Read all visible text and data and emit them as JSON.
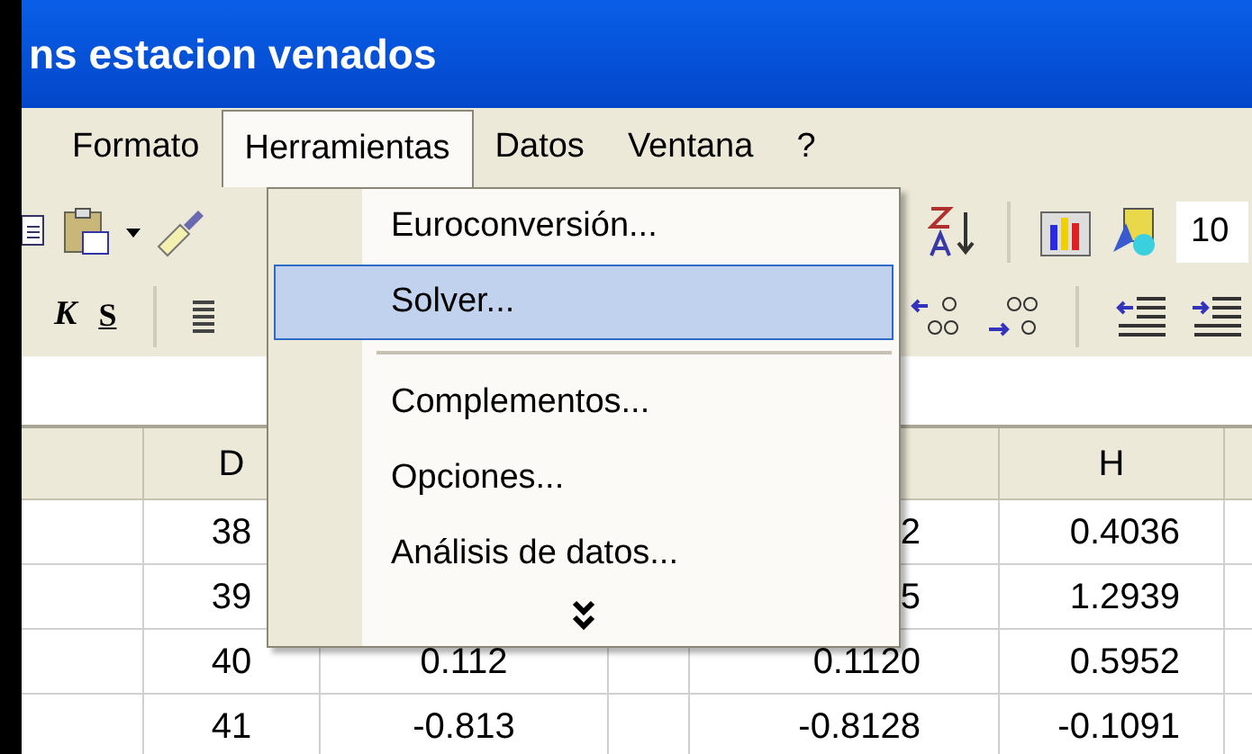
{
  "window": {
    "title": "ns estacion venados"
  },
  "menu_bar": [
    {
      "label": "Formato",
      "open": false
    },
    {
      "label": "Herramientas",
      "open": true
    },
    {
      "label": "Datos",
      "open": false
    },
    {
      "label": "Ventana",
      "open": false
    },
    {
      "label": "?",
      "open": false
    }
  ],
  "zoom_field": {
    "value": "10"
  },
  "format_buttons": [
    {
      "label": "K",
      "kind": "italic"
    },
    {
      "label": "S",
      "kind": "underline"
    }
  ],
  "columns": [
    {
      "label": "D"
    },
    {
      "label": "H"
    }
  ],
  "rows": [
    {
      "d": "38",
      "g": "2",
      "h": "0.4036"
    },
    {
      "d": "39",
      "g": "5",
      "h": "1.2939"
    },
    {
      "d": "40",
      "e": "0.112",
      "g": "0.1120",
      "h": "0.5952"
    },
    {
      "d": "41",
      "e": "-0.813",
      "g": "-0.8128",
      "h": "-0.1091"
    }
  ],
  "menu": [
    {
      "kind": "item",
      "label": "Euroconversión...",
      "selected": false
    },
    {
      "kind": "item",
      "label": "Solver...",
      "selected": true
    },
    {
      "kind": "separator"
    },
    {
      "kind": "item",
      "label": "Complementos...",
      "selected": false
    },
    {
      "kind": "item",
      "label": "Opciones...",
      "selected": false
    },
    {
      "kind": "item",
      "label": "Análisis de datos...",
      "selected": false
    },
    {
      "kind": "more"
    }
  ]
}
